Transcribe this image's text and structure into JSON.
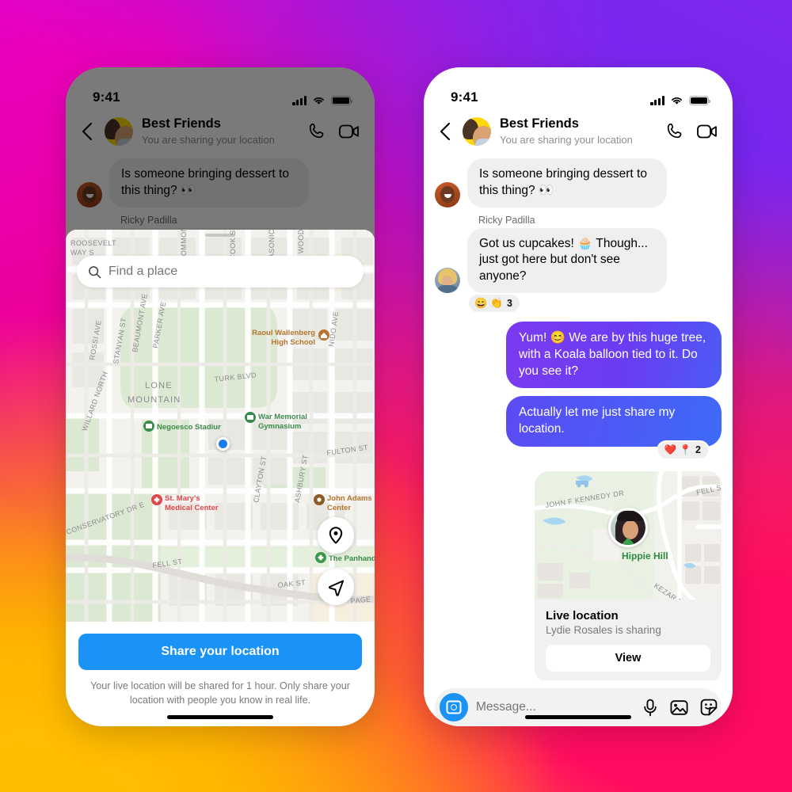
{
  "background": {
    "gradient_colors": [
      "#E800C4",
      "#7226F0",
      "#FF0B62",
      "#FFC400"
    ]
  },
  "status_bar": {
    "time": "9:41",
    "signal_icon": "cellular-bars-icon",
    "wifi_icon": "wifi-icon",
    "battery_icon": "battery-full-icon"
  },
  "chat_header": {
    "back_icon": "chevron-left-icon",
    "avatar": "group-avatar",
    "title": "Best Friends",
    "subtitle": "You are sharing your location",
    "call_icon": "phone-icon",
    "video_icon": "video-camera-icon"
  },
  "left_phone": {
    "map_sheet": {
      "search_placeholder": "Find a place",
      "search_icon": "search-icon",
      "grabber": "sheet-grabber",
      "locate_icon": "map-pin-icon",
      "navigate_icon": "navigation-arrow-icon",
      "user_dot": "current-location-dot",
      "labels": {
        "areas": [
          "LONE",
          "MOUNTAIN"
        ],
        "streets": [
          "ROOSEVELT WAY",
          "COMMONWEAL",
          "COOK ST",
          "MASONIC AVE",
          "STANYAN ST",
          "BEAUMONT AVE",
          "PARKER AVE",
          "ROSSI AVE",
          "NIDO AVE",
          "WILLARD NORTH",
          "TURK BLVD",
          "FULTON ST",
          "CLAYTON ST",
          "ASHBURY ST",
          "FELL ST",
          "OAK ST",
          "CONSERVATORY DR E",
          "PAGE ST"
        ],
        "places": [
          {
            "name": "Raoul Wallenberg High School",
            "kind": "school",
            "color": "#B5752E"
          },
          {
            "name": "Negoesco Stadiur",
            "kind": "park",
            "color": "#3A8A4A"
          },
          {
            "name": "War Memorial Gymnasium",
            "kind": "park",
            "color": "#3A8A4A"
          },
          {
            "name": "St. Mary's Medical Center",
            "kind": "hospital",
            "color": "#E0484C"
          },
          {
            "name": "John Adams Center",
            "kind": "school",
            "color": "#B5752E"
          },
          {
            "name": "The Panhandle",
            "kind": "park",
            "color": "#3A8A4A"
          }
        ]
      },
      "share_button": "Share your location",
      "share_button_color": "#1B92F5",
      "disclaimer": "Your live location will be shared for 1 hour. Only share your location with people you know in real life."
    }
  },
  "right_phone": {
    "messages": [
      {
        "id": "m1",
        "direction": "incoming",
        "avatar": "avatar-jackie",
        "text": "Is someone bringing dessert to this thing? 👀"
      },
      {
        "id": "m2",
        "direction": "incoming",
        "sender": "Ricky Padilla",
        "avatar": "avatar-ricky",
        "text": "Got us cupcakes! 🧁 Though... just got here but don't see anyone?",
        "reaction": {
          "emojis": "😄 👏",
          "count": "3"
        }
      },
      {
        "id": "m3",
        "direction": "outgoing",
        "text": "Yum! 😊 We are by this huge tree, with a Koala balloon tied to it. Do you see it?"
      },
      {
        "id": "m4",
        "direction": "outgoing",
        "text": "Actually let me just share my location.",
        "reaction": {
          "emojis": "❤️ 📍",
          "count": "2"
        }
      }
    ],
    "location_card": {
      "title": "Live location",
      "subtitle": "Lydie Rosales is sharing",
      "button": "View",
      "map_labels": [
        "JOHN F KENNEDY DR",
        "FELL ST",
        "KEZAR DR",
        "Hippie Hill"
      ],
      "avatar": "avatar-lydie-map"
    },
    "composer": {
      "camera_icon": "camera-button",
      "placeholder": "Message...",
      "mic_icon": "microphone-icon",
      "gallery_icon": "image-icon",
      "sticker_icon": "sticker-icon"
    }
  }
}
